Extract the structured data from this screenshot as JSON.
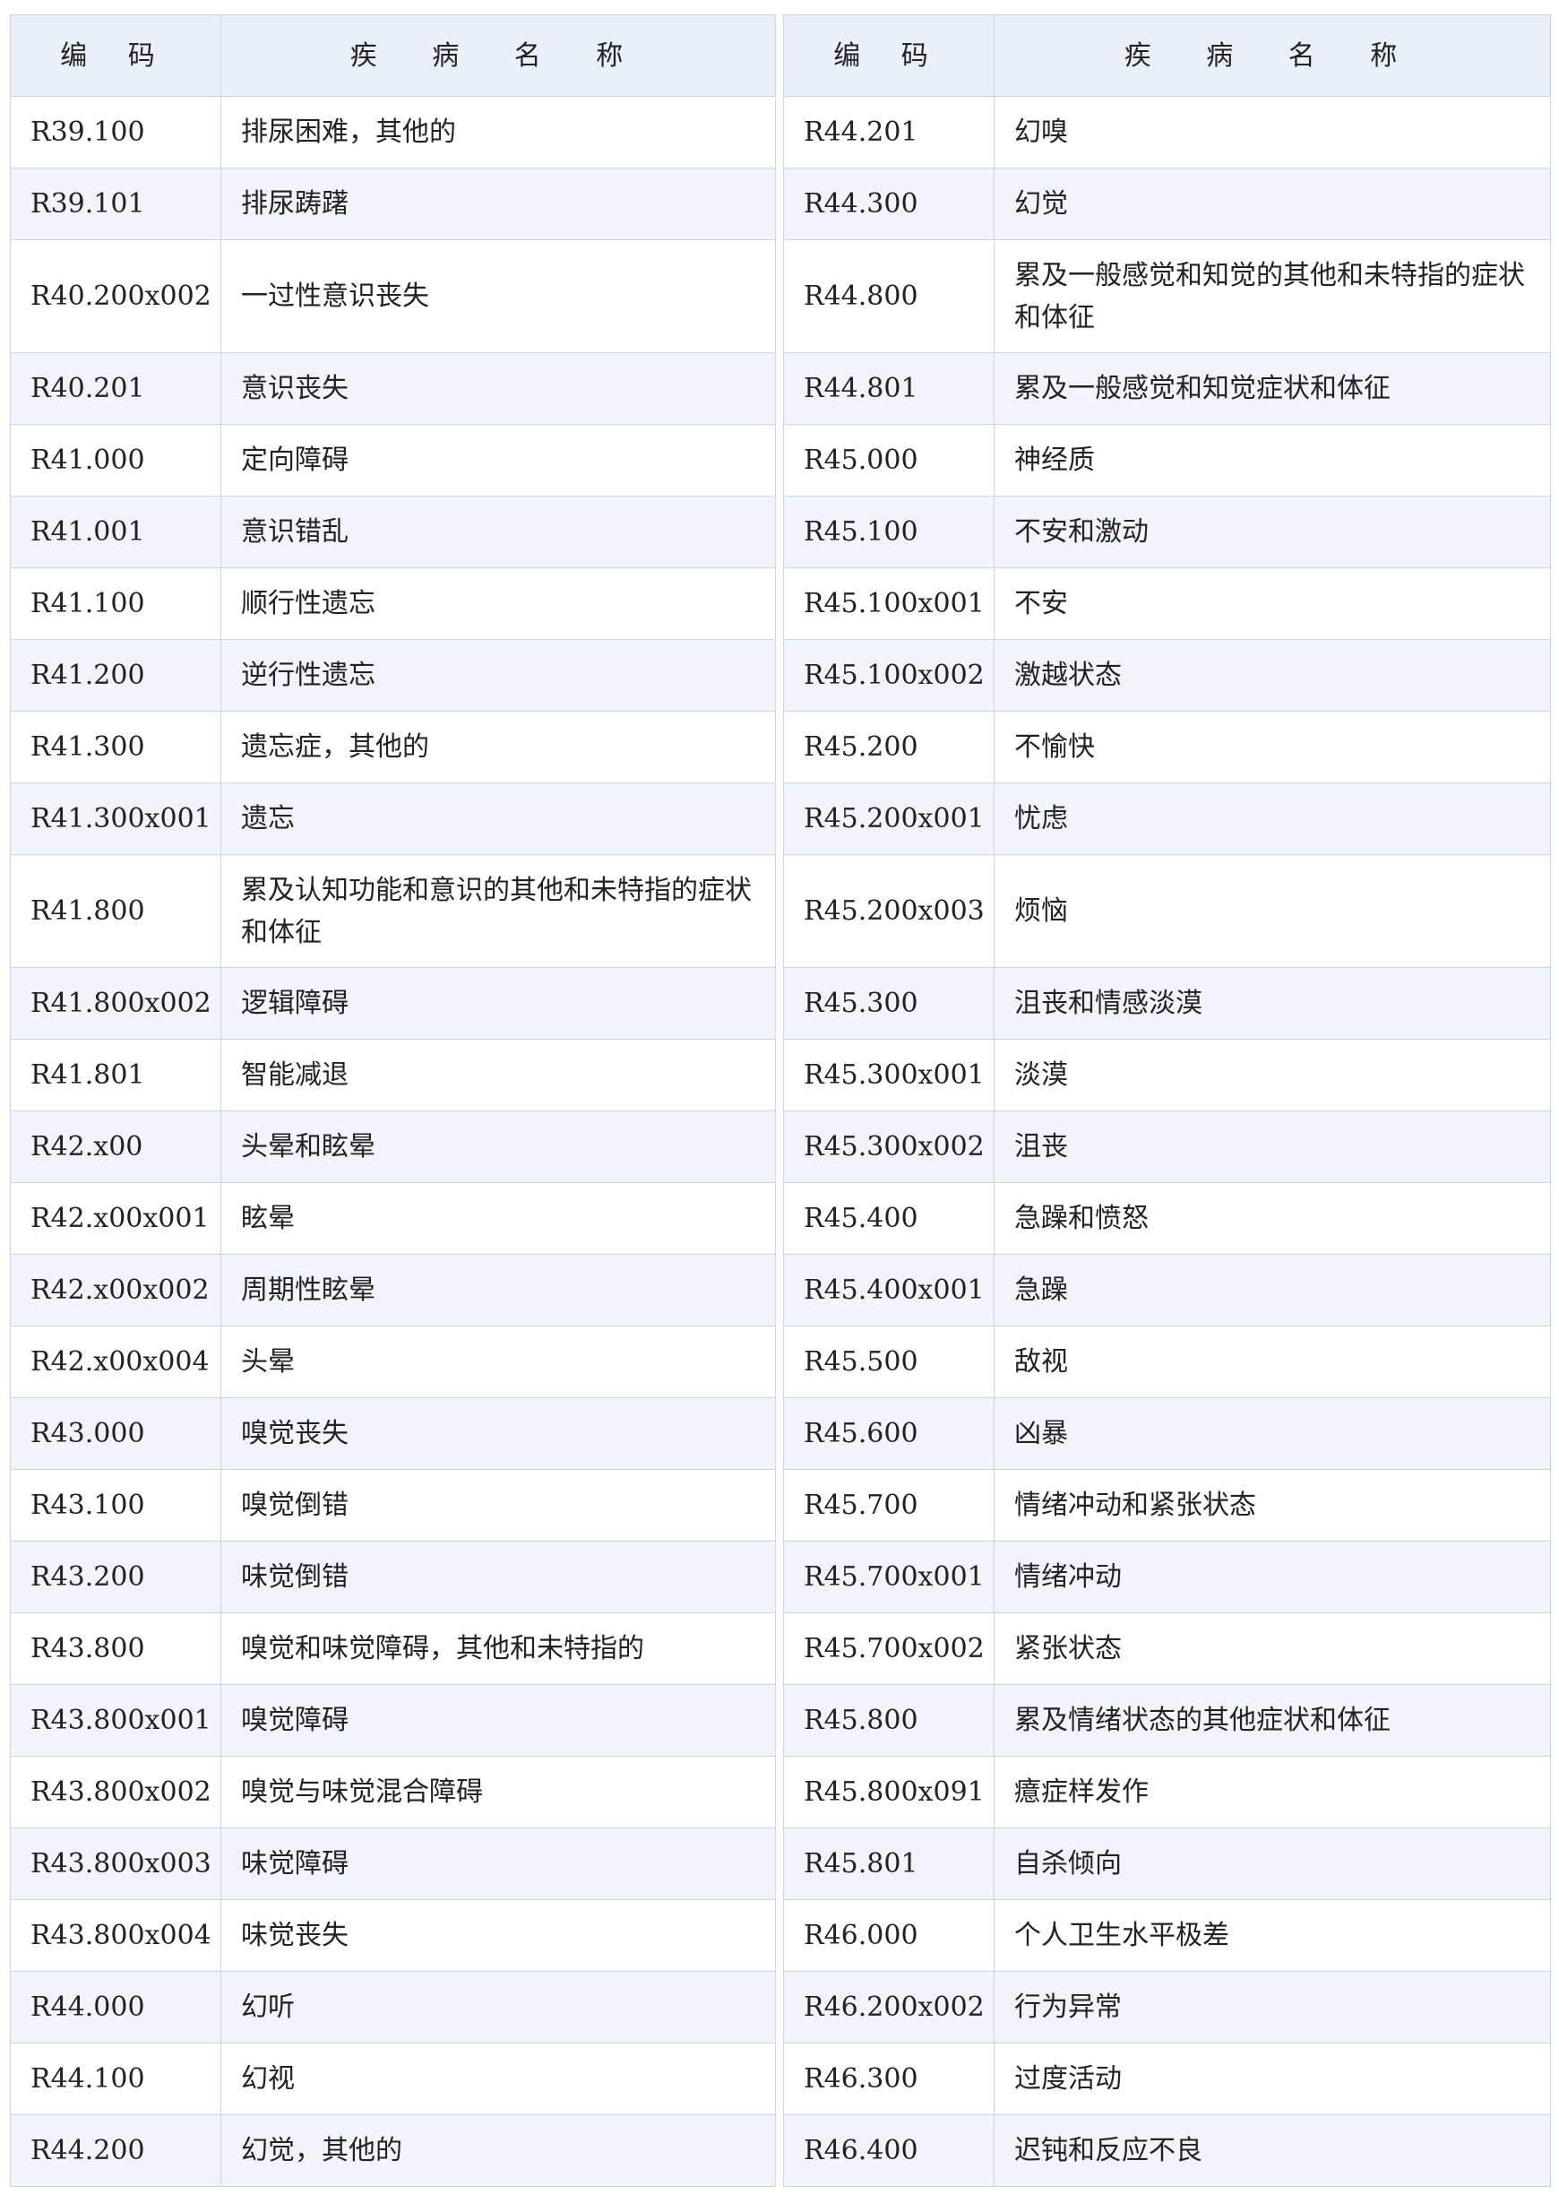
{
  "headers": {
    "code": "编 码",
    "name": "疾 病 名 称"
  },
  "left_rows": [
    {
      "code": "R39.100",
      "name": "排尿困难，其他的"
    },
    {
      "code": "R39.101",
      "name": "排尿踌躇"
    },
    {
      "code": "R40.200x002",
      "name": "一过性意识丧失"
    },
    {
      "code": "R40.201",
      "name": "意识丧失"
    },
    {
      "code": "R41.000",
      "name": "定向障碍"
    },
    {
      "code": "R41.001",
      "name": "意识错乱"
    },
    {
      "code": "R41.100",
      "name": "顺行性遗忘"
    },
    {
      "code": "R41.200",
      "name": "逆行性遗忘"
    },
    {
      "code": "R41.300",
      "name": "遗忘症，其他的"
    },
    {
      "code": "R41.300x001",
      "name": "遗忘"
    },
    {
      "code": "R41.800",
      "name": "累及认知功能和意识的其他和未特指的症状和体征"
    },
    {
      "code": "R41.800x002",
      "name": "逻辑障碍"
    },
    {
      "code": "R41.801",
      "name": "智能减退"
    },
    {
      "code": "R42.x00",
      "name": "头晕和眩晕"
    },
    {
      "code": "R42.x00x001",
      "name": "眩晕"
    },
    {
      "code": "R42.x00x002",
      "name": "周期性眩晕"
    },
    {
      "code": "R42.x00x004",
      "name": "头晕"
    },
    {
      "code": "R43.000",
      "name": "嗅觉丧失"
    },
    {
      "code": "R43.100",
      "name": "嗅觉倒错"
    },
    {
      "code": "R43.200",
      "name": "味觉倒错"
    },
    {
      "code": "R43.800",
      "name": "嗅觉和味觉障碍，其他和未特指的"
    },
    {
      "code": "R43.800x001",
      "name": "嗅觉障碍"
    },
    {
      "code": "R43.800x002",
      "name": "嗅觉与味觉混合障碍"
    },
    {
      "code": "R43.800x003",
      "name": "味觉障碍"
    },
    {
      "code": "R43.800x004",
      "name": "味觉丧失"
    },
    {
      "code": "R44.000",
      "name": "幻听"
    },
    {
      "code": "R44.100",
      "name": "幻视"
    },
    {
      "code": "R44.200",
      "name": "幻觉，其他的"
    }
  ],
  "right_rows": [
    {
      "code": "R44.201",
      "name": "幻嗅"
    },
    {
      "code": "R44.300",
      "name": "幻觉"
    },
    {
      "code": "R44.800",
      "name": "累及一般感觉和知觉的其他和未特指的症状和体征"
    },
    {
      "code": "R44.801",
      "name": "累及一般感觉和知觉症状和体征"
    },
    {
      "code": "R45.000",
      "name": "神经质"
    },
    {
      "code": "R45.100",
      "name": "不安和激动"
    },
    {
      "code": "R45.100x001",
      "name": "不安"
    },
    {
      "code": "R45.100x002",
      "name": "激越状态"
    },
    {
      "code": "R45.200",
      "name": "不愉快"
    },
    {
      "code": "R45.200x001",
      "name": "忧虑"
    },
    {
      "code": "R45.200x003",
      "name": "烦恼"
    },
    {
      "code": "R45.300",
      "name": "沮丧和情感淡漠"
    },
    {
      "code": "R45.300x001",
      "name": "淡漠"
    },
    {
      "code": "R45.300x002",
      "name": "沮丧"
    },
    {
      "code": "R45.400",
      "name": "急躁和愤怒"
    },
    {
      "code": "R45.400x001",
      "name": "急躁"
    },
    {
      "code": "R45.500",
      "name": "敌视"
    },
    {
      "code": "R45.600",
      "name": "凶暴"
    },
    {
      "code": "R45.700",
      "name": "情绪冲动和紧张状态"
    },
    {
      "code": "R45.700x001",
      "name": "情绪冲动"
    },
    {
      "code": "R45.700x002",
      "name": "紧张状态"
    },
    {
      "code": "R45.800",
      "name": "累及情绪状态的其他症状和体征"
    },
    {
      "code": "R45.800x091",
      "name": "癔症样发作"
    },
    {
      "code": "R45.801",
      "name": "自杀倾向"
    },
    {
      "code": "R46.000",
      "name": "个人卫生水平极差"
    },
    {
      "code": "R46.200x002",
      "name": "行为异常"
    },
    {
      "code": "R46.300",
      "name": "过度活动"
    },
    {
      "code": "R46.400",
      "name": "迟钝和反应不良"
    }
  ]
}
